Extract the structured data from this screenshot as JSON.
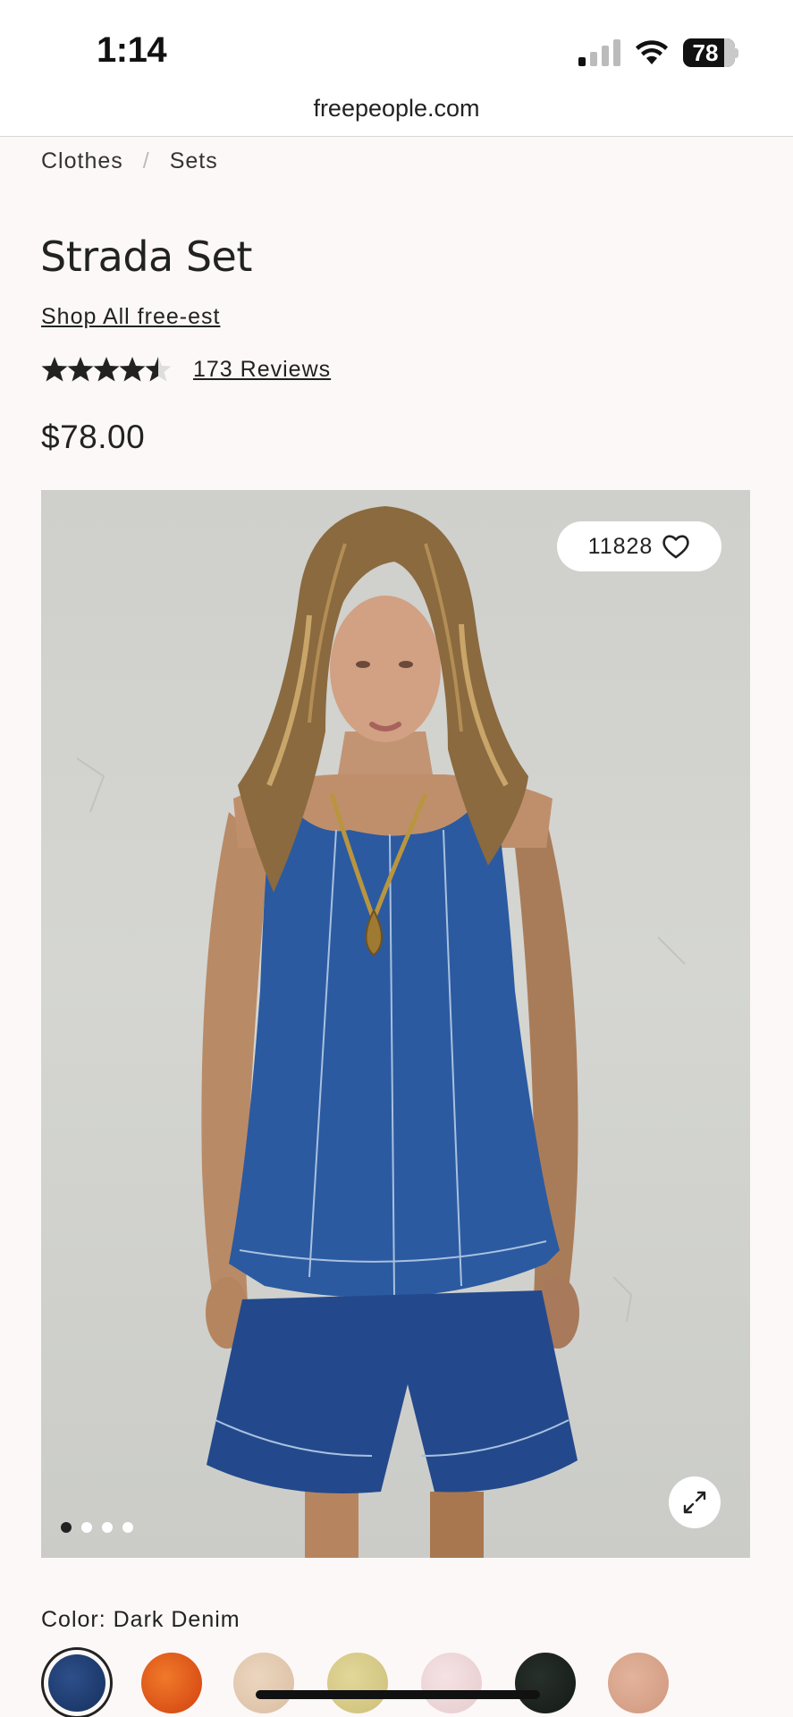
{
  "status_bar": {
    "time": "1:14",
    "battery": "78"
  },
  "browser": {
    "url": "freepeople.com"
  },
  "breadcrumb": {
    "items": [
      "Clothes",
      "Sets"
    ],
    "separator": "/"
  },
  "product": {
    "title": "Strada Set",
    "shop_link": "Shop All free-est",
    "rating_value": 4.5,
    "reviews_link": "173 Reviews",
    "price": "$78.00",
    "like_count": "11828",
    "image_count": 4,
    "active_image": 1
  },
  "color": {
    "label": "Color: Dark Denim",
    "swatches": [
      {
        "name": "dark-denim",
        "color": "#1e3a6e",
        "selected": true
      },
      {
        "name": "orange",
        "color": "#e05a1c"
      },
      {
        "name": "beige",
        "color": "#e3c9b0"
      },
      {
        "name": "yellow",
        "color": "#d8cc8a"
      },
      {
        "name": "pink",
        "color": "#efd6d8"
      },
      {
        "name": "black",
        "color": "#1b211d"
      },
      {
        "name": "tan",
        "color": "#d9a58c"
      }
    ]
  }
}
